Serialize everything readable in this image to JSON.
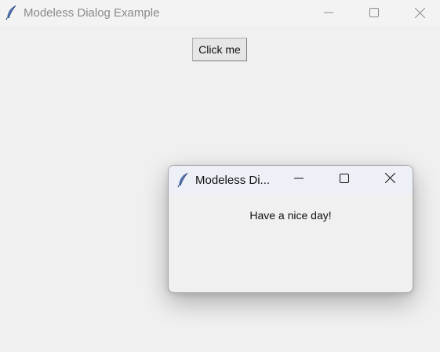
{
  "main_window": {
    "title": "Modeless Dialog Example",
    "title_icon": "feather-icon",
    "controls": {
      "minimize_icon": "minimize-icon",
      "maximize_icon": "maximize-icon",
      "close_icon": "close-icon"
    },
    "button": {
      "label": "Click me"
    }
  },
  "dialog": {
    "title": "Modeless Di...",
    "title_icon": "feather-icon",
    "controls": {
      "minimize_icon": "minimize-icon",
      "maximize_icon": "maximize-icon",
      "close_icon": "close-icon"
    },
    "message": "Have a nice day!"
  },
  "colors": {
    "window_background": "#f0f0f0",
    "titlebar_background": "#f3f3f3",
    "dialog_titlebar_background": "#eef0f7",
    "inactive_title_text": "#8a8a8a"
  }
}
